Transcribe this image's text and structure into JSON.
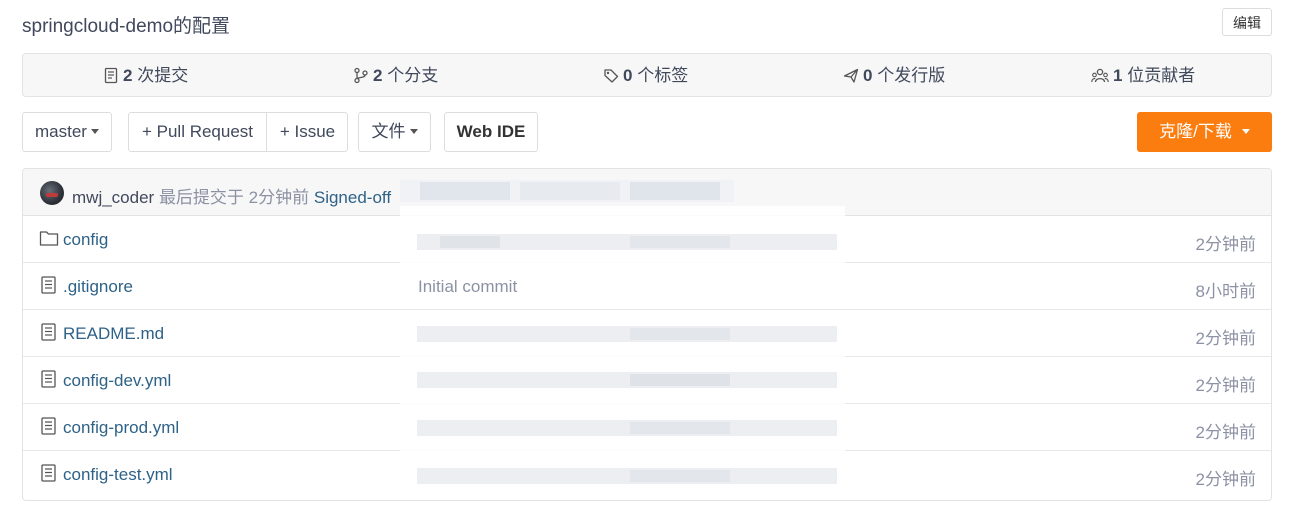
{
  "repo": {
    "title": "springcloud-demo的配置",
    "edit_label": "编辑"
  },
  "stats": {
    "commits": {
      "count": "2",
      "label": "次提交",
      "icon": "commit-icon"
    },
    "branches": {
      "count": "2",
      "label": "个分支",
      "icon": "branch-icon"
    },
    "tags": {
      "count": "0",
      "label": "个标签",
      "icon": "tag-icon"
    },
    "releases": {
      "count": "0",
      "label": "个发行版",
      "icon": "release-icon"
    },
    "contributors": {
      "count": "1",
      "label": "位贡献者",
      "icon": "contributors-icon"
    }
  },
  "toolbar": {
    "branch": "master",
    "pull_request": "+ Pull Request",
    "issue": "+ Issue",
    "files": "文件",
    "web_ide": "Web IDE",
    "clone": "克隆/下载",
    "clone_color": "#fb7d10"
  },
  "commit": {
    "user": "mwj_coder",
    "meta": "最后提交于 2分钟前",
    "message": "Signed-off"
  },
  "files": [
    {
      "name": "config",
      "type": "folder",
      "message": "",
      "time": "2分钟前"
    },
    {
      "name": ".gitignore",
      "type": "file",
      "message": "Initial commit",
      "time": "8小时前"
    },
    {
      "name": "README.md",
      "type": "file",
      "message": "",
      "time": "2分钟前"
    },
    {
      "name": "config-dev.yml",
      "type": "file",
      "message": "",
      "time": "2分钟前"
    },
    {
      "name": "config-prod.yml",
      "type": "file",
      "message": "",
      "time": "2分钟前"
    },
    {
      "name": "config-test.yml",
      "type": "file",
      "message": "",
      "time": "2分钟前"
    }
  ]
}
